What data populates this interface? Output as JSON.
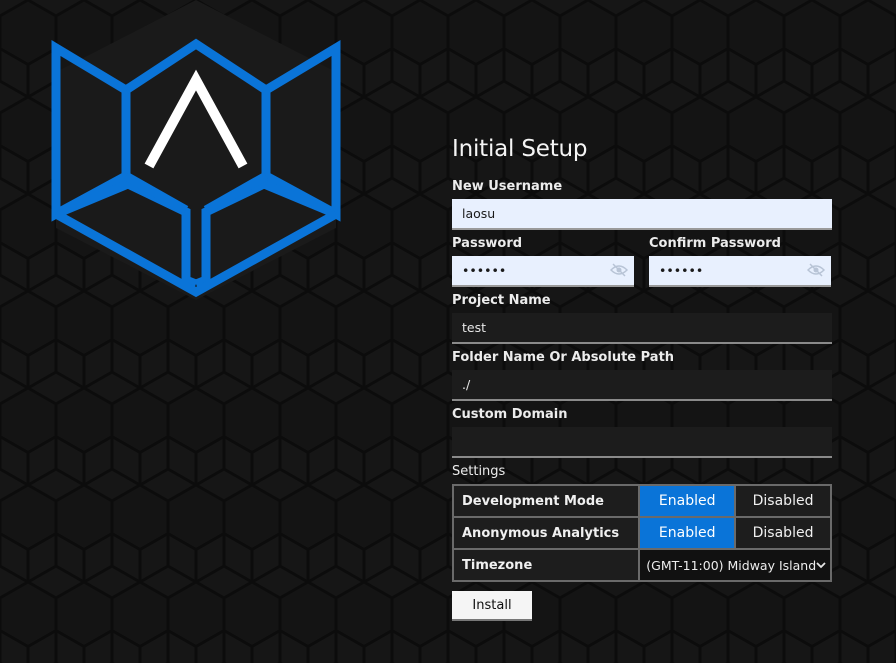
{
  "title": "Initial Setup",
  "username": {
    "label": "New Username",
    "value": "laosu"
  },
  "password": {
    "label": "Password",
    "value": "••••••"
  },
  "confirm_password": {
    "label": "Confirm Password",
    "value": "••••••"
  },
  "project_name": {
    "label": "Project Name",
    "value": "test"
  },
  "folder": {
    "label": "Folder Name Or Absolute Path",
    "value": "./"
  },
  "custom_domain": {
    "label": "Custom Domain",
    "value": ""
  },
  "settings": {
    "label": "Settings",
    "dev_mode": {
      "label": "Development Mode",
      "enabled": "Enabled",
      "disabled": "Disabled",
      "selected": "Enabled"
    },
    "analytics": {
      "label": "Anonymous Analytics",
      "enabled": "Enabled",
      "disabled": "Disabled",
      "selected": "Enabled"
    },
    "timezone": {
      "label": "Timezone",
      "value": "(GMT-11:00) Midway Island"
    }
  },
  "install_label": "Install",
  "colors": {
    "accent": "#0a74d8",
    "background": "#121212"
  },
  "icons": {
    "logo": "hexagon-shield-logo",
    "password_toggle": "eye-slash-icon",
    "dropdown": "chevron-down-icon"
  }
}
